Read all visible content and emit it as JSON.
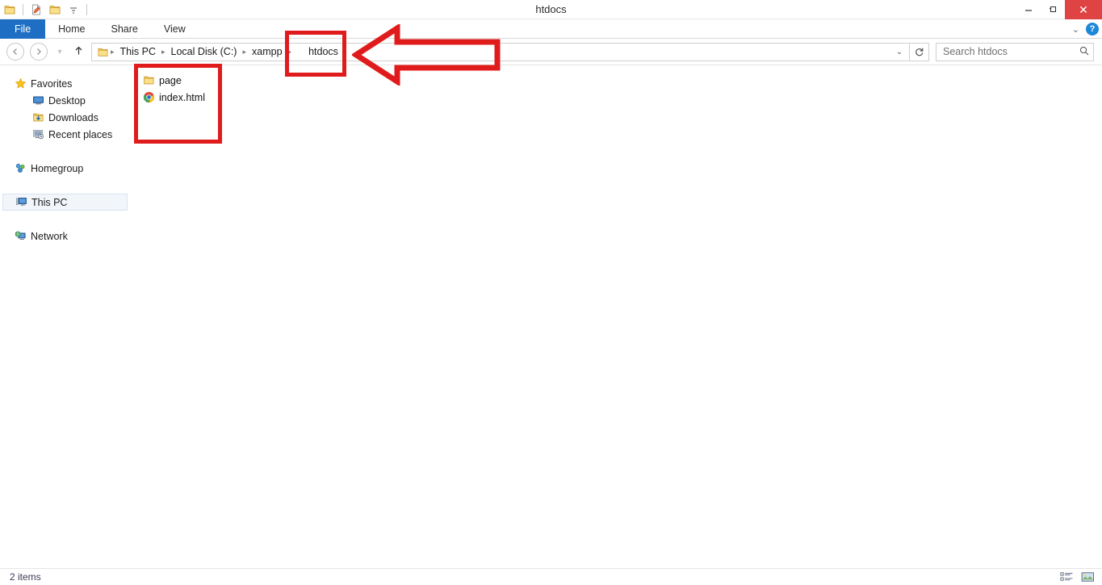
{
  "window": {
    "title": "htdocs",
    "controls": {
      "minimize": "–",
      "maximize": "❐",
      "close": "✕"
    }
  },
  "quick_access": {
    "items": [
      {
        "name": "folder-icon",
        "label": ""
      },
      {
        "name": "properties-icon",
        "label": ""
      },
      {
        "name": "new-folder-icon",
        "label": ""
      },
      {
        "name": "customize-dropdown-icon",
        "label": "▾"
      }
    ]
  },
  "ribbon": {
    "tabs": [
      {
        "label": "File",
        "active": true
      },
      {
        "label": "Home",
        "active": false
      },
      {
        "label": "Share",
        "active": false
      },
      {
        "label": "View",
        "active": false
      }
    ],
    "collapse_chevron": "⌄",
    "help_label": "?"
  },
  "navigation": {
    "back": "←",
    "forward": "→",
    "history": "▾",
    "up": "↑",
    "refresh": "↺"
  },
  "breadcrumb": {
    "separator": "▸",
    "segments": [
      "This PC",
      "Local Disk (C:)",
      "xampp",
      "htdocs"
    ],
    "dropdown": "⌄"
  },
  "search": {
    "placeholder": "Search htdocs",
    "icon": "🔍"
  },
  "sidebar": {
    "groups": [
      {
        "label": "Favorites",
        "icon": "star-icon",
        "children": [
          {
            "label": "Desktop",
            "icon": "desktop-icon"
          },
          {
            "label": "Downloads",
            "icon": "downloads-icon"
          },
          {
            "label": "Recent places",
            "icon": "recent-places-icon"
          }
        ]
      },
      {
        "label": "Homegroup",
        "icon": "homegroup-icon",
        "children": []
      },
      {
        "label": "This PC",
        "icon": "this-pc-icon",
        "children": [],
        "selected": true
      },
      {
        "label": "Network",
        "icon": "network-icon",
        "children": []
      }
    ]
  },
  "files": {
    "items": [
      {
        "name": "page",
        "icon": "folder-icon",
        "type": "folder"
      },
      {
        "name": "index.html",
        "icon": "chrome-icon",
        "type": "file"
      }
    ]
  },
  "status": {
    "item_count": "2 items",
    "view_details": "details-view",
    "view_icons": "large-icons-view"
  },
  "annotations": {
    "highlight_color": "#e01b1b",
    "crumb_box_target": "htdocs",
    "files_box_target": "file-list",
    "arrow_direction": "left"
  }
}
